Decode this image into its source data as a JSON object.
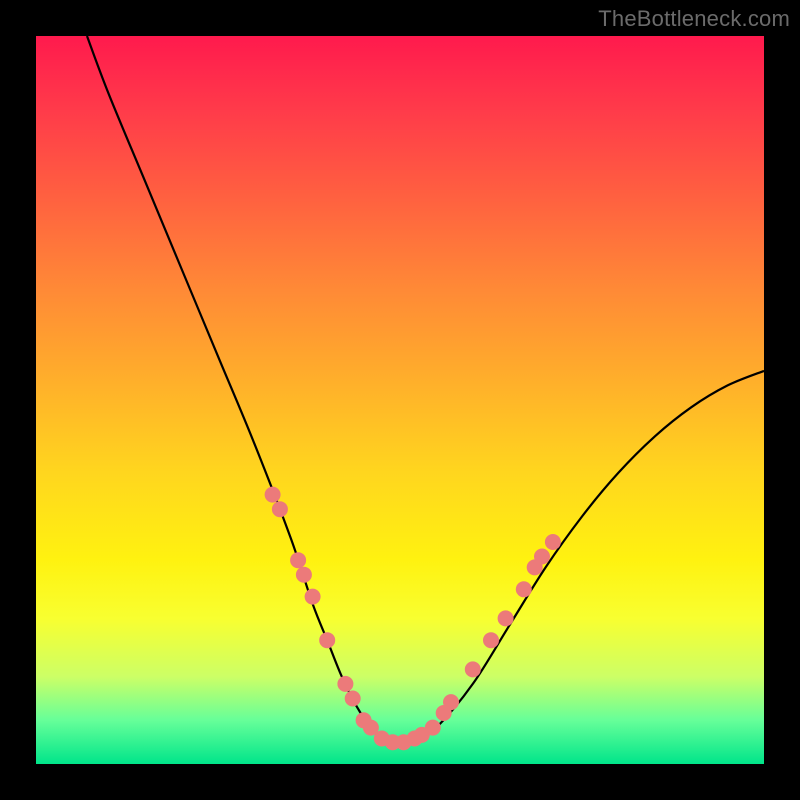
{
  "watermark": "TheBottleneck.com",
  "colors": {
    "curve": "#000000",
    "marker_fill": "#ec7a7a",
    "marker_stroke": "#cc5f5f",
    "background_frame": "#000000"
  },
  "chart_data": {
    "type": "line",
    "title": "",
    "xlabel": "",
    "ylabel": "",
    "xlim": [
      0,
      100
    ],
    "ylim": [
      0,
      100
    ],
    "grid": false,
    "legend": false,
    "series": [
      {
        "name": "curve",
        "x": [
          7,
          10,
          15,
          20,
          25,
          30,
          35,
          38,
          40,
          42,
          44,
          46,
          48,
          50,
          52,
          55,
          60,
          65,
          70,
          75,
          80,
          85,
          90,
          95,
          100
        ],
        "y": [
          100,
          92,
          80,
          68,
          56,
          44,
          31,
          22,
          17,
          12,
          8,
          5,
          3,
          2.5,
          3,
          5,
          11,
          19,
          27,
          34,
          40,
          45,
          49,
          52,
          54
        ]
      }
    ],
    "markers": [
      {
        "x": 32.5,
        "y": 37
      },
      {
        "x": 33.5,
        "y": 35
      },
      {
        "x": 36.0,
        "y": 28
      },
      {
        "x": 36.8,
        "y": 26
      },
      {
        "x": 38.0,
        "y": 23
      },
      {
        "x": 40.0,
        "y": 17
      },
      {
        "x": 42.5,
        "y": 11
      },
      {
        "x": 43.5,
        "y": 9
      },
      {
        "x": 45.0,
        "y": 6
      },
      {
        "x": 46.0,
        "y": 5
      },
      {
        "x": 47.5,
        "y": 3.5
      },
      {
        "x": 49.0,
        "y": 3
      },
      {
        "x": 50.5,
        "y": 3
      },
      {
        "x": 52.0,
        "y": 3.5
      },
      {
        "x": 53.0,
        "y": 4
      },
      {
        "x": 54.5,
        "y": 5
      },
      {
        "x": 56.0,
        "y": 7
      },
      {
        "x": 57.0,
        "y": 8.5
      },
      {
        "x": 60.0,
        "y": 13
      },
      {
        "x": 62.5,
        "y": 17
      },
      {
        "x": 64.5,
        "y": 20
      },
      {
        "x": 67.0,
        "y": 24
      },
      {
        "x": 68.5,
        "y": 27
      },
      {
        "x": 69.5,
        "y": 28.5
      },
      {
        "x": 71.0,
        "y": 30.5
      }
    ]
  }
}
